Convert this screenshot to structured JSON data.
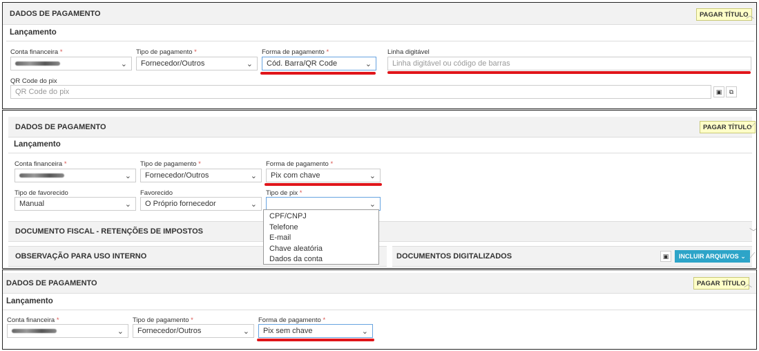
{
  "panel1": {
    "section_title": "DADOS DE PAGAMENTO",
    "pay_button": "PAGAR TÍTULO",
    "subheader": "Lançamento",
    "labels": {
      "conta": "Conta financeira",
      "tipo_pagamento": "Tipo de pagamento",
      "forma_pagamento": "Forma de pagamento",
      "linha": "Linha digitável",
      "qr": "QR Code do pix"
    },
    "required_mark": "*",
    "values": {
      "tipo_pagamento": "Fornecedor/Outros",
      "forma_pagamento": "Cód. Barra/QR Code"
    },
    "placeholders": {
      "linha": "Linha digitável ou código de barras",
      "qr": "QR Code do pix"
    }
  },
  "panel2": {
    "section_title": "DADOS DE PAGAMENTO",
    "pay_button": "PAGAR TÍTULO",
    "subheader": "Lançamento",
    "labels": {
      "conta": "Conta financeira",
      "tipo_pagamento": "Tipo de pagamento",
      "forma_pagamento": "Forma de pagamento",
      "tipo_favorecido": "Tipo de favorecido",
      "favorecido": "Favorecido",
      "tipo_pix": "Tipo de pix"
    },
    "required_mark": "*",
    "values": {
      "tipo_pagamento": "Fornecedor/Outros",
      "forma_pagamento": "Pix com chave",
      "tipo_favorecido": "Manual",
      "favorecido": "O Próprio fornecedor",
      "tipo_pix": ""
    },
    "pix_options": [
      "CPF/CNPJ",
      "Telefone",
      "E-mail",
      "Chave aleatória",
      "Dados da conta"
    ],
    "section_fiscal": "DOCUMENTO FISCAL - RETENÇÕES DE IMPOSTOS",
    "section_obs": "OBSERVAÇÃO PARA USO INTERNO",
    "section_docs": "DOCUMENTOS DIGITALIZADOS",
    "incluir_button": "INCLUIR ARQUIVOS"
  },
  "panel3": {
    "section_title": "DADOS DE PAGAMENTO",
    "pay_button": "PAGAR TÍTULO",
    "subheader": "Lançamento",
    "labels": {
      "conta": "Conta financeira",
      "tipo_pagamento": "Tipo de pagamento",
      "forma_pagamento": "Forma de pagamento"
    },
    "required_mark": "*",
    "values": {
      "tipo_pagamento": "Fornecedor/Outros",
      "forma_pagamento": "Pix sem chave"
    }
  },
  "colors": {
    "highlight": "#e0161b",
    "pay_button_bg": "#ffffc8",
    "incluir_bg": "#2da4c8",
    "required": "#d9534f"
  }
}
